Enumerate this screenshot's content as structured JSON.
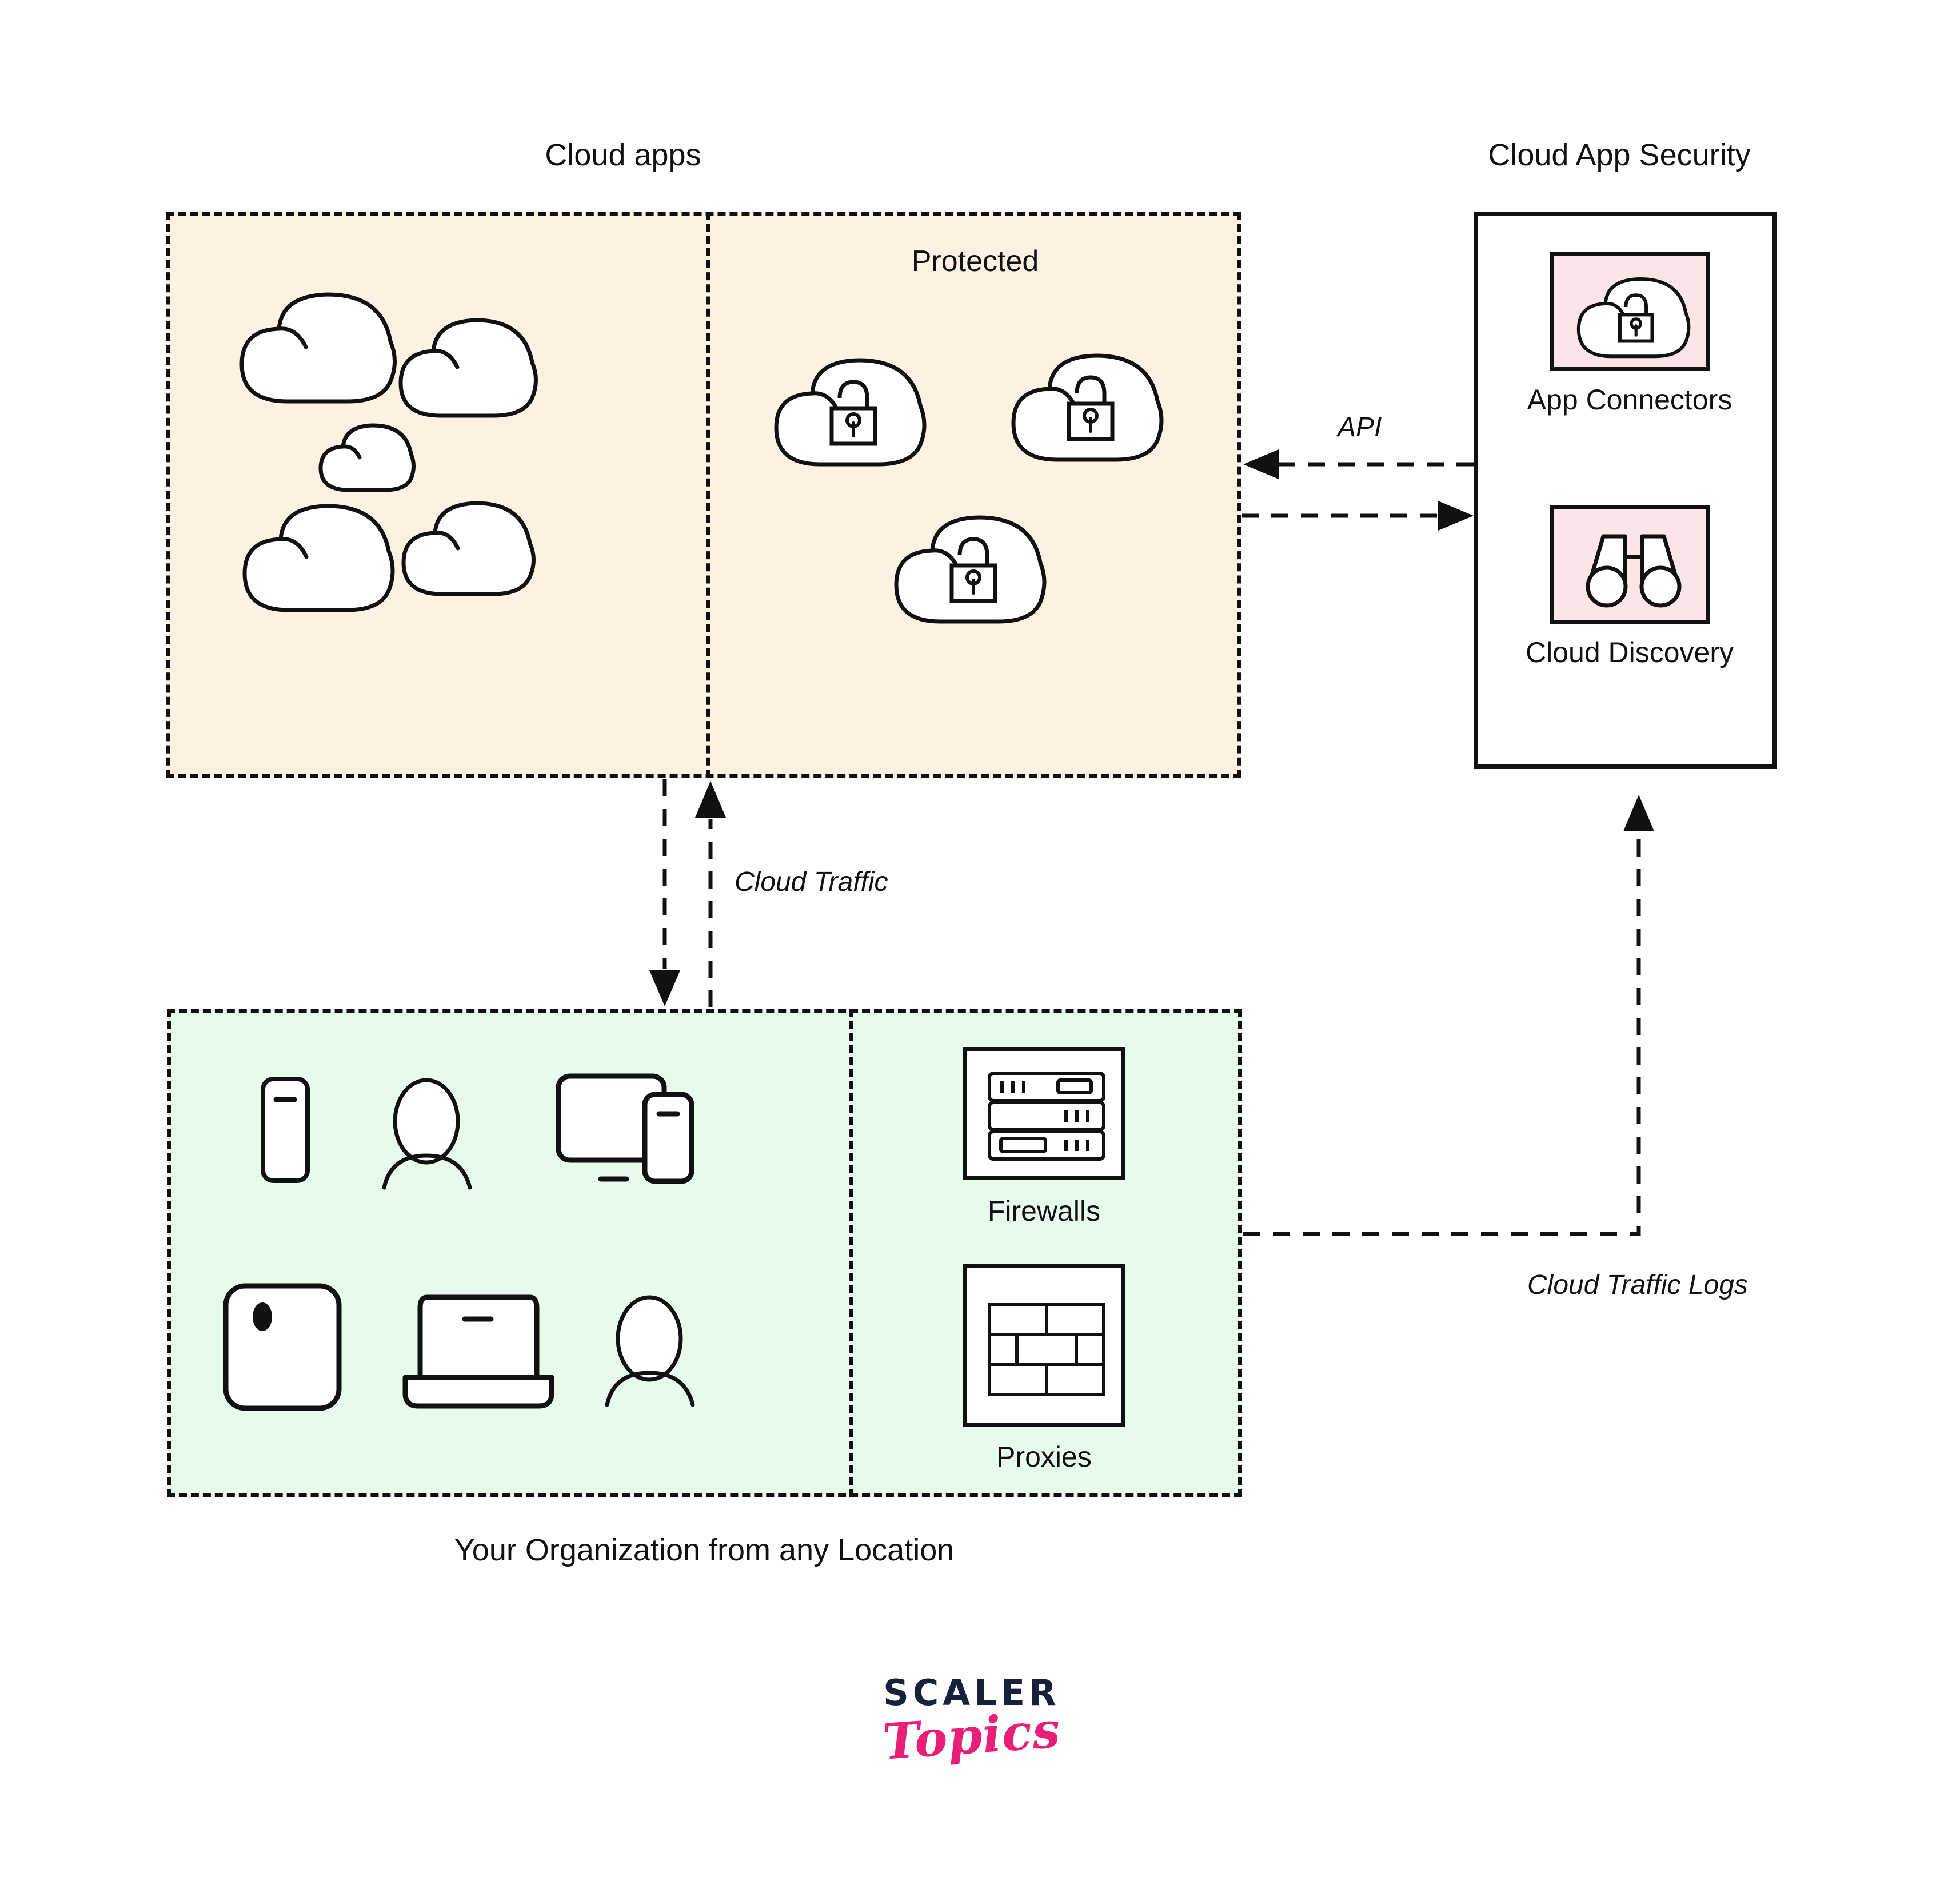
{
  "diagram": {
    "title_cloud_apps": "Cloud apps",
    "title_cloud_app_security": "Cloud App Security",
    "label_protected": "Protected",
    "label_org_caption": "Your Organization from any Location",
    "flow_labels": {
      "api": "API",
      "cloud_traffic": "Cloud Traffic",
      "cloud_traffic_logs": "Cloud Traffic Logs"
    },
    "security_panel": {
      "tiles": [
        {
          "label": "App Connectors",
          "icon": "cloud-lock-icon"
        },
        {
          "label": "Cloud Discovery",
          "icon": "binoculars-icon"
        }
      ]
    },
    "network_tiles": [
      {
        "label": "Firewalls",
        "icon": "server-rack-icon"
      },
      {
        "label": "Proxies",
        "icon": "brick-wall-icon"
      }
    ],
    "unprotected_clouds": [
      {
        "icon": "cloud-icon",
        "size": "large"
      },
      {
        "icon": "cloud-icon",
        "size": "medium"
      },
      {
        "icon": "cloud-icon",
        "size": "small"
      },
      {
        "icon": "cloud-icon",
        "size": "large"
      },
      {
        "icon": "cloud-icon",
        "size": "medium"
      }
    ],
    "protected_clouds": [
      {
        "icon": "cloud-lock-icon"
      },
      {
        "icon": "cloud-lock-icon"
      },
      {
        "icon": "cloud-lock-icon"
      }
    ],
    "org_devices": [
      {
        "icon": "smartphone-icon"
      },
      {
        "icon": "person-icon"
      },
      {
        "icon": "monitor-and-phone-icon"
      },
      {
        "icon": "tablet-icon"
      },
      {
        "icon": "laptop-icon"
      },
      {
        "icon": "person-icon"
      }
    ],
    "colors": {
      "cloud_apps_fill": "#FDF2E2",
      "organization_fill": "#E6FBEB",
      "security_tile_fill": "#FCE5E8",
      "stroke": "#111111",
      "logo_dark": "#17213C",
      "logo_pink": "#E91E76"
    }
  },
  "logo": {
    "primary": "SCALER",
    "secondary": "Topics"
  }
}
